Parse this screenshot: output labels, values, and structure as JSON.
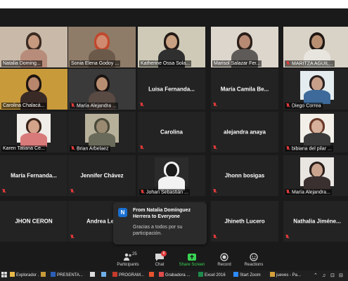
{
  "participants": [
    {
      "row": 0,
      "col": 0,
      "name": "Natalia Doming...",
      "mode": "video",
      "muted": false
    },
    {
      "row": 0,
      "col": 1,
      "name": "Sonia Elena Godoy ...",
      "mode": "video",
      "muted": false
    },
    {
      "row": 0,
      "col": 2,
      "name": "Katherine Ossa Sola...",
      "mode": "video",
      "muted": false,
      "active": true
    },
    {
      "row": 0,
      "col": 3,
      "name": "Marisol Salazar Fer...",
      "mode": "video",
      "muted": false
    },
    {
      "row": 0,
      "col": 4,
      "name": "MARITZA AGUIL...",
      "mode": "video",
      "muted": true
    },
    {
      "row": 1,
      "col": 0,
      "name": "Carolina Chalacá...",
      "mode": "video",
      "muted": false
    },
    {
      "row": 1,
      "col": 1,
      "name": "María Alejandra ...",
      "mode": "video",
      "muted": true
    },
    {
      "row": 1,
      "col": 2,
      "name": "Luisa Fernanda...",
      "mode": "name",
      "muted": true
    },
    {
      "row": 1,
      "col": 3,
      "name": "María Camila Be...",
      "mode": "name",
      "muted": true
    },
    {
      "row": 1,
      "col": 4,
      "name": "Diego Correa",
      "mode": "video",
      "muted": true
    },
    {
      "row": 2,
      "col": 0,
      "name": "Karen Tatiana Ce...",
      "mode": "video",
      "muted": false
    },
    {
      "row": 2,
      "col": 1,
      "name": "Brian Arbelaez",
      "mode": "video",
      "muted": true
    },
    {
      "row": 2,
      "col": 2,
      "name": "Carolina",
      "mode": "name",
      "muted": true
    },
    {
      "row": 2,
      "col": 3,
      "name": "alejandra anaya",
      "mode": "name",
      "muted": true
    },
    {
      "row": 2,
      "col": 4,
      "name": "bibiana del pilar ...",
      "mode": "video",
      "muted": true
    },
    {
      "row": 3,
      "col": 0,
      "name": "María Fernanda...",
      "mode": "name",
      "muted": true
    },
    {
      "row": 3,
      "col": 1,
      "name": "Jennifer Chávez",
      "mode": "name",
      "muted": true
    },
    {
      "row": 3,
      "col": 2,
      "name": "Johan Sebastián ...",
      "mode": "video",
      "muted": true
    },
    {
      "row": 3,
      "col": 3,
      "name": "Jhonn bosigas",
      "mode": "name",
      "muted": true
    },
    {
      "row": 3,
      "col": 4,
      "name": "María Alejandra...",
      "mode": "video",
      "muted": true
    },
    {
      "row": 4,
      "col": 0,
      "name": "JHON CERON",
      "mode": "name",
      "muted": false
    },
    {
      "row": 4,
      "col": 1,
      "name": "Andrea Leu",
      "mode": "name",
      "muted": true
    },
    {
      "row": 4,
      "col": 2,
      "name": "",
      "mode": "name",
      "muted": false
    },
    {
      "row": 4,
      "col": 3,
      "name": "Jhineth Lucero",
      "mode": "name",
      "muted": true
    },
    {
      "row": 4,
      "col": 4,
      "name": "Nathalia Jiméne...",
      "mode": "name",
      "muted": true
    }
  ],
  "notification": {
    "avatar_letter": "N",
    "title": "From Natalia Domínguez Herrera to Everyone",
    "message": "Gracias a todos por su participación."
  },
  "controls": {
    "participants": {
      "label": "Participants",
      "count": "25"
    },
    "chat": {
      "label": "Chat",
      "badge": "6"
    },
    "share": {
      "label": "Share Screen"
    },
    "record": {
      "label": "Record"
    },
    "reactions": {
      "label": "Reactions"
    }
  },
  "taskbar": {
    "items": [
      {
        "label": "Explorador ...",
        "color": "#e8b84a"
      },
      {
        "label": "",
        "color": "#c89b3a"
      },
      {
        "label": "PRESENTA...",
        "color": "#2b5fb8"
      },
      {
        "label": "",
        "color": "#dddddd"
      },
      {
        "label": "",
        "color": "#6fb0e8"
      },
      {
        "label": "PROGRAM...",
        "color": "#c63b2b"
      },
      {
        "label": "",
        "color": "#e8532e"
      },
      {
        "label": "Grabadora ...",
        "color": "#e04b4b"
      },
      {
        "label": "Excel 2016",
        "color": "#1f8a4c"
      },
      {
        "label": "Start Zoom",
        "color": "#2d8cff"
      },
      {
        "label": "jueves - Pa...",
        "color": "#d4a13a"
      }
    ],
    "tray": [
      "⌃",
      "♫",
      "⊡",
      "⊟"
    ]
  }
}
